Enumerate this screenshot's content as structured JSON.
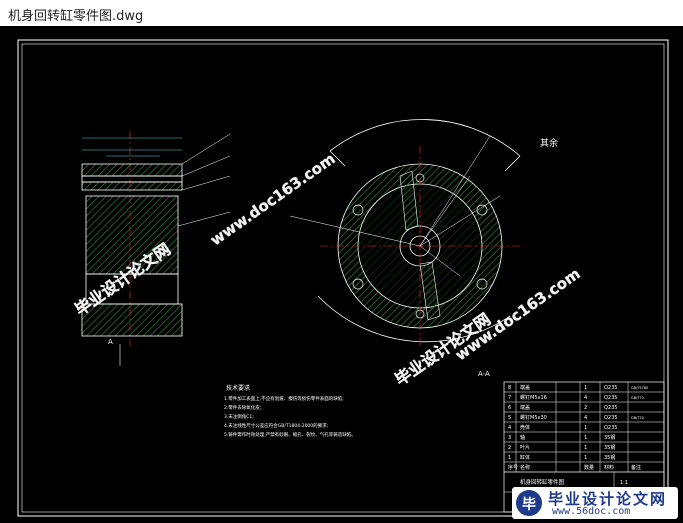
{
  "window": {
    "title": "机身回转缸零件图.dwg"
  },
  "colors": {
    "canvas": "#000000",
    "line": "#ffffff",
    "hatch": "#2e7d32",
    "center": "#ff2020",
    "dim": "#4dd0e1",
    "watermark": "#ffffff"
  },
  "drawing": {
    "roughness_note": "其余",
    "section_label": "A-A",
    "tech_req_title": "技术要求",
    "tech_req_lines": [
      "1.零件加工表面上,不应有划痕、擦伤等损伤零件表面的缺陷;",
      "2.零件去除氧化皮;",
      "3.未注倒角C1;",
      "4.未注线性尺寸公差应符合GB/T1804-2000的要求;",
      "5.铸件需作时效处理,严禁有砂眼、缩孔、裂纹、气孔等铸造缺陷。"
    ],
    "part_labels": [
      "1",
      "2",
      "3",
      "4",
      "5",
      "6",
      "7"
    ],
    "bom": {
      "rows": [
        [
          "8",
          "端盖",
          "1",
          "",
          "Q235",
          "GB/T5782"
        ],
        [
          "7",
          "螺钉M5x16",
          "4",
          "",
          "Q235",
          "GB/T70"
        ],
        [
          "6",
          "端盖",
          "2",
          "",
          "Q235",
          ""
        ],
        [
          "5",
          "螺钉M5x30",
          "4",
          "",
          "Q235",
          "GB/T70"
        ],
        [
          "4",
          "壳体",
          "1",
          "",
          "Q235",
          ""
        ],
        [
          "3",
          "轴",
          "1",
          "",
          "35钢",
          ""
        ],
        [
          "2",
          "叶片",
          "1",
          "",
          "35钢",
          ""
        ],
        [
          "1",
          "缸体",
          "1",
          "",
          "35钢",
          ""
        ]
      ],
      "header": [
        "序号",
        "名称",
        "数量",
        "",
        "材料",
        "备注"
      ],
      "drawing_title": "机身回转缸零件图",
      "scale": "1:1",
      "sheet": "A2"
    }
  },
  "watermarks": {
    "text_cn": "毕业设计论文网",
    "text_url": "www.doc163.com"
  },
  "logo": {
    "name": "毕业设计论文网",
    "url": "www.56doc.com"
  }
}
